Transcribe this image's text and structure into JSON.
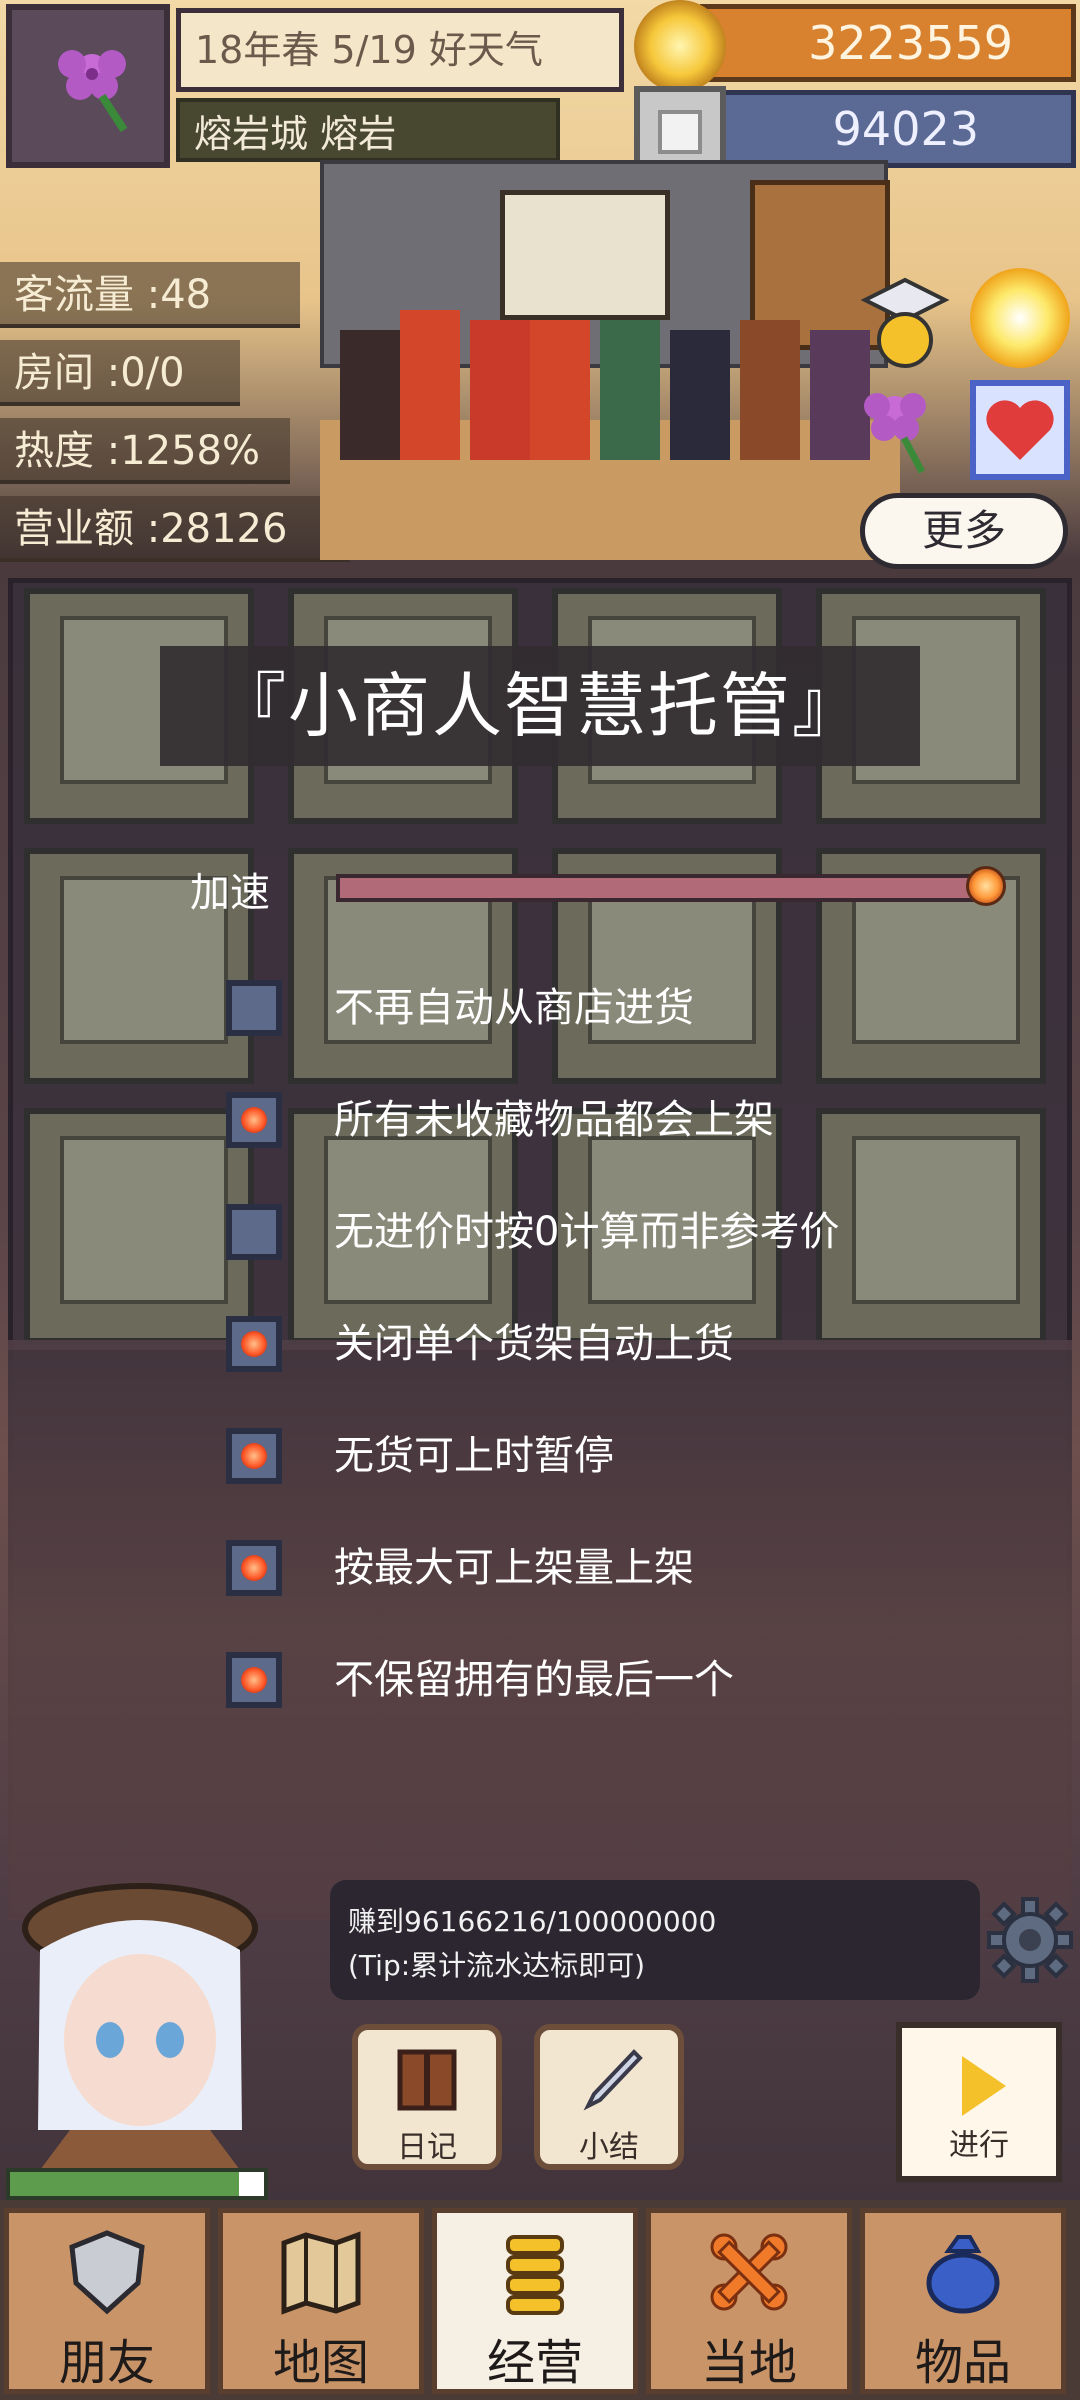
{
  "hud": {
    "date_weather": "18年春 5/19 好天气",
    "location": "熔岩城 熔岩",
    "coins": "3223559",
    "gems": "94023"
  },
  "stats": {
    "traffic": "客流量 :48",
    "rooms": "房间 :0/0",
    "heat": "热度 :1258%",
    "revenue": "营业额 :28126"
  },
  "more_button": "更多",
  "panel": {
    "title": "『小商人智慧托管』",
    "speed_label": "加速",
    "speed_value": 1.0,
    "options": [
      {
        "label": "不再自动从商店进货",
        "checked": false
      },
      {
        "label": "所有未收藏物品都会上架",
        "checked": true
      },
      {
        "label": "无进价时按0计算而非参考价",
        "checked": false
      },
      {
        "label": "关闭单个货架自动上货",
        "checked": true
      },
      {
        "label": "无货可上时暂停",
        "checked": true
      },
      {
        "label": "按最大可上架量上架",
        "checked": true
      },
      {
        "label": "不保留拥有的最后一个",
        "checked": true
      }
    ]
  },
  "goal": {
    "progress_text": "赚到96166216/100000000",
    "tip": "(Tip:累计流水达标即可)"
  },
  "actions": {
    "diary": "日记",
    "summary": "小结",
    "proceed": "进行"
  },
  "hp_fraction": 0.9,
  "nav": [
    {
      "label": "朋友",
      "icon": "shield-icon"
    },
    {
      "label": "地图",
      "icon": "map-icon"
    },
    {
      "label": "经营",
      "icon": "coins-icon"
    },
    {
      "label": "当地",
      "icon": "bone-icon"
    },
    {
      "label": "物品",
      "icon": "bag-icon"
    }
  ],
  "colors": {
    "accent": "#f4c12a",
    "checkbox_on": "#ff5a2a",
    "panel": "#372e3a"
  }
}
